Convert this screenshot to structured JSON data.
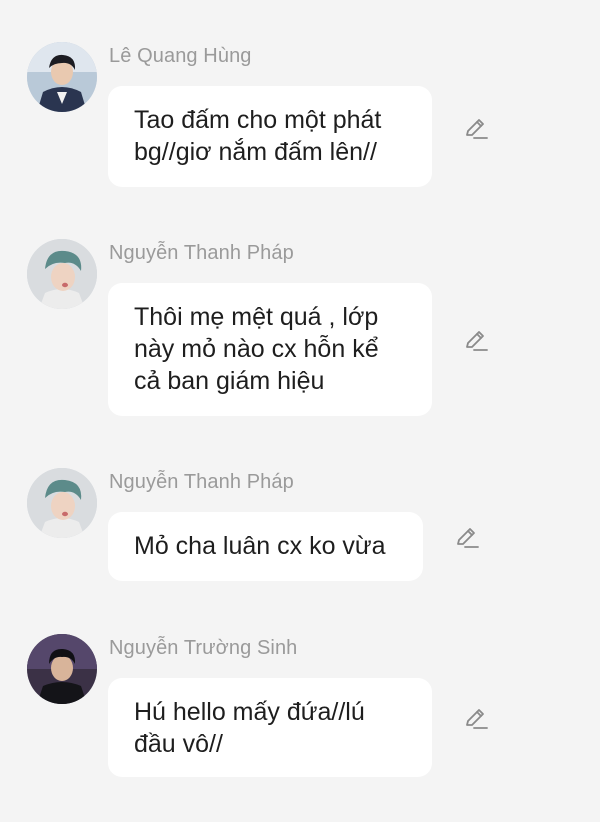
{
  "messages": [
    {
      "sender": "Lê Quang Hùng",
      "avatar": "avatar-photo",
      "lines": [
        "Tao đấm cho một phát",
        "bg//giơ nắm đấm lên//"
      ],
      "action_icon": "edit-pencil-icon"
    },
    {
      "sender": "Nguyễn Thanh Pháp",
      "avatar": "avatar-photo",
      "lines": [
        "Thôi mẹ mệt quá , lớp",
        "này mỏ nào cx hỗn kể",
        "cả ban giám hiệu"
      ],
      "action_icon": "edit-pencil-icon"
    },
    {
      "sender": "Nguyễn Thanh Pháp",
      "avatar": "avatar-photo",
      "lines": [
        "Mỏ cha luân cx ko vừa"
      ],
      "action_icon": "edit-pencil-icon"
    },
    {
      "sender": "Nguyễn Trường Sinh",
      "avatar": "avatar-photo",
      "lines": [
        "Hú hello mấy đứa//lú",
        "đầu vô//"
      ],
      "action_icon": "edit-pencil-icon"
    }
  ],
  "colors": {
    "background": "#f4f4f4",
    "bubble": "#ffffff",
    "sender_text": "#9a9a9a",
    "message_text": "#1e1e1e",
    "icon": "#8a8a8a"
  }
}
